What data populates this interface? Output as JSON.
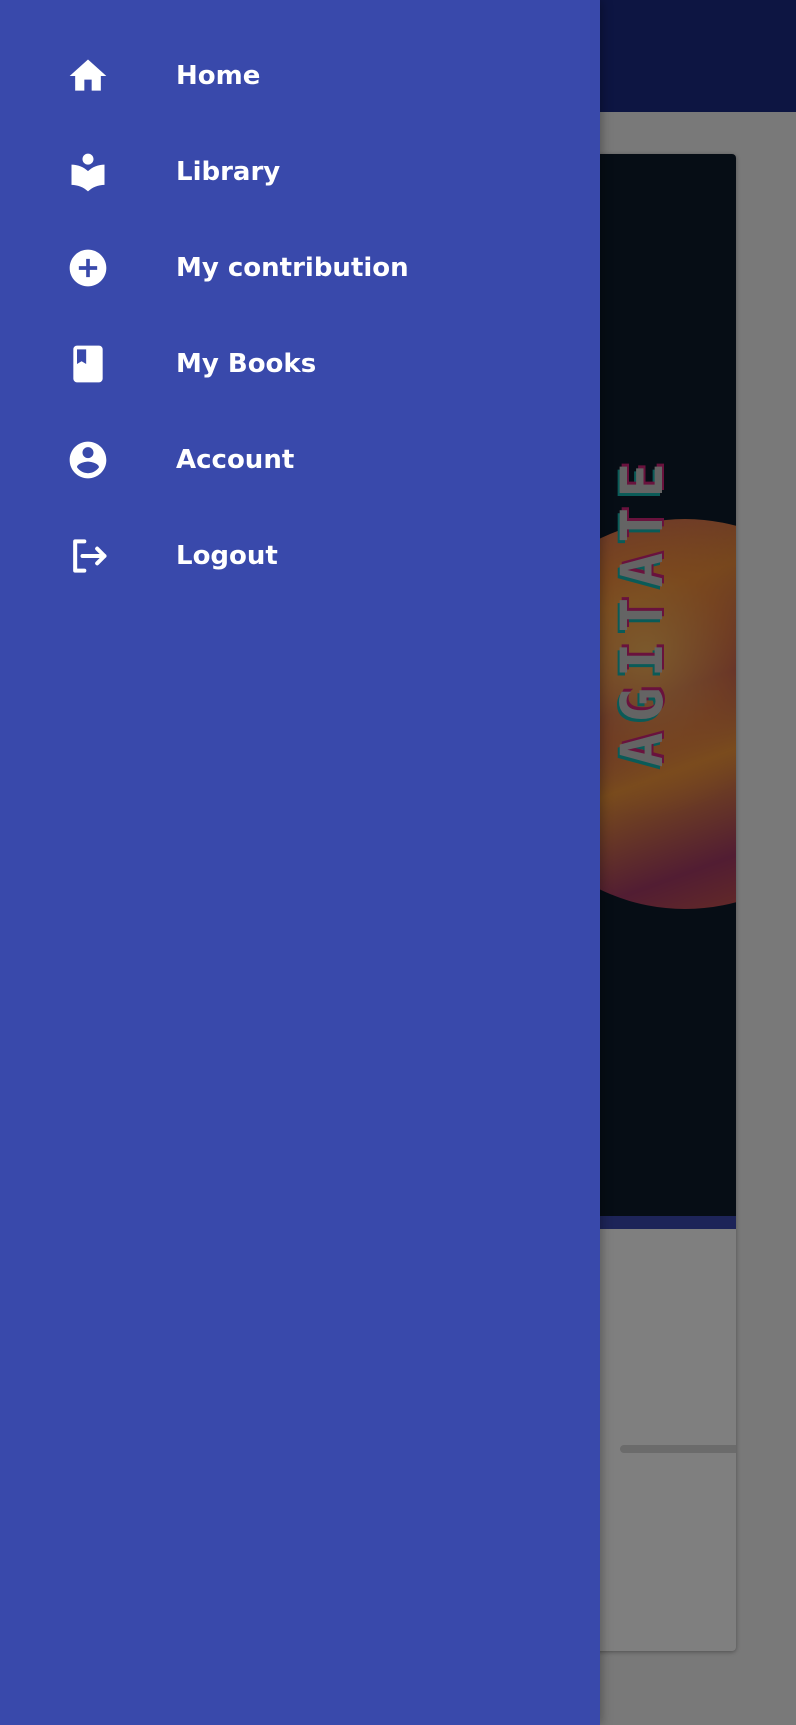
{
  "drawer": {
    "items": [
      {
        "label": "Home",
        "icon": "home-icon"
      },
      {
        "label": "Library",
        "icon": "library-icon"
      },
      {
        "label": "My contribution",
        "icon": "add-circle-icon"
      },
      {
        "label": "My Books",
        "icon": "book-icon"
      },
      {
        "label": "Account",
        "icon": "account-circle-icon"
      },
      {
        "label": "Logout",
        "icon": "logout-icon"
      }
    ]
  },
  "book_card": {
    "cover_title": "AGITATE"
  },
  "colors": {
    "drawer_background": "#3949ab",
    "app_bar": "#1a2a85",
    "scrim": "rgba(0,0,0,0.5)",
    "icon_and_text": "#ffffff"
  }
}
